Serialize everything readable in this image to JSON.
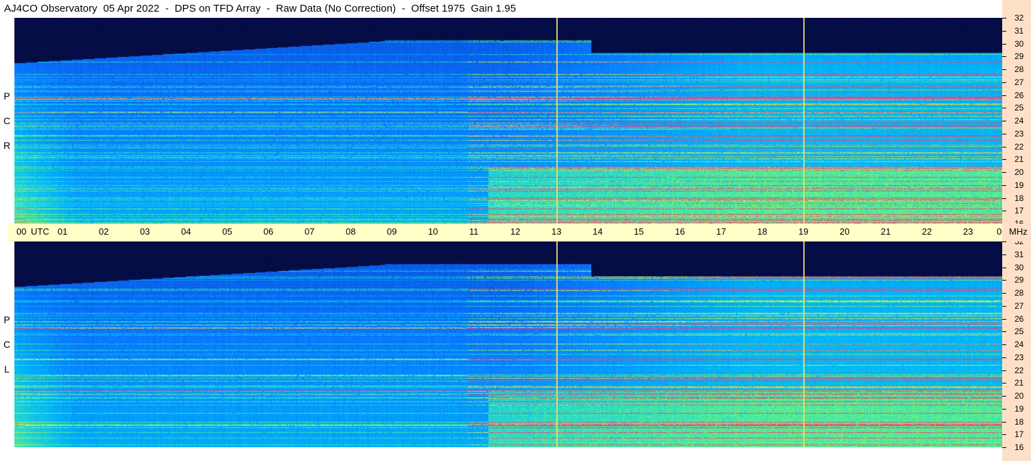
{
  "title": "AJ4CO Observatory  05 Apr 2022  -  DPS on TFD Array  -  Raw Data (No Correction)  -  Offset 1975  Gain 1.95",
  "panels": [
    {
      "id": "rcp",
      "letters": [
        "R",
        "C",
        "P"
      ]
    },
    {
      "id": "lcp",
      "letters": [
        "L",
        "C",
        "P"
      ]
    }
  ],
  "time_axis": {
    "labels": [
      "00",
      "01",
      "02",
      "03",
      "04",
      "05",
      "06",
      "07",
      "08",
      "09",
      "10",
      "11",
      "12",
      "13",
      "14",
      "15",
      "16",
      "17",
      "18",
      "19",
      "20",
      "21",
      "22",
      "23",
      "00"
    ],
    "start_suffix": "UTC",
    "end_suffix": "MHz"
  },
  "freq_axis": {
    "labels": [
      "32",
      "31",
      "30",
      "29",
      "28",
      "27",
      "26",
      "25",
      "24",
      "23",
      "22",
      "21",
      "20",
      "19",
      "18",
      "17",
      "16"
    ]
  },
  "chart_data": {
    "type": "heatmap",
    "title": "AJ4CO Observatory  05 Apr 2022  -  DPS on TFD Array  -  Raw Data (No Correction)  -  Offset 1975  Gain 1.95",
    "x_range_hours": [
      0,
      24
    ],
    "y_range_mhz": [
      16,
      32
    ],
    "marker_lines_utc": [
      13.17,
      19.17
    ],
    "colors": {
      "low": "#02061e",
      "mid": "#0a66ff",
      "high": "#7df56a",
      "peak": "#ff2a6a",
      "marker": "#e8e070"
    }
  }
}
